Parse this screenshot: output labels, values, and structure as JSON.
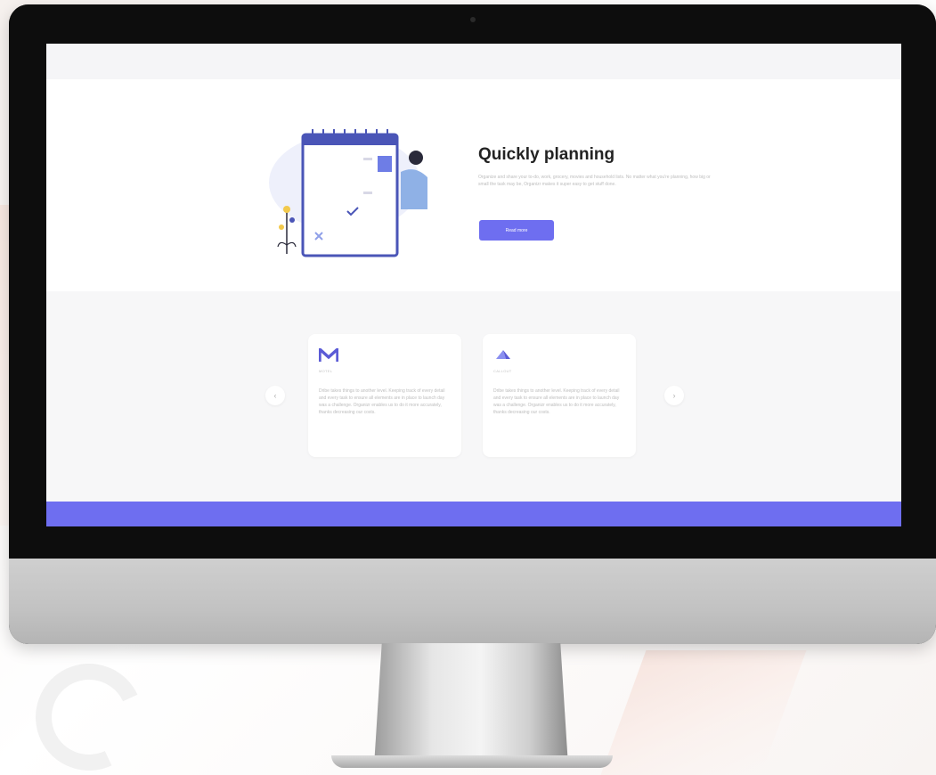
{
  "hero": {
    "title": "Quickly planning",
    "description": "Organize and share your to-do, work, grocery, movies and household lists. No matter what you're planning, how big or small the task may be, Organizr makes it super easy to get stuff done.",
    "button_label": "Read more"
  },
  "features": {
    "cards": [
      {
        "logo_icon": "m-logo-icon",
        "logo_text": "MOTEL",
        "text": "Dribe takes things to another level. Keeping track of every detail and every task to ensure all elements are in place to launch day was a challenge. Organizr enables us to do it more accurately, thanks decreasing our costs."
      },
      {
        "logo_icon": "megaphone-logo-icon",
        "logo_text": "CALLOUT",
        "text": "Dribe takes things to another level. Keeping track of every detail and every task to ensure all elements are in place to launch day was a challenge. Organizr enables us to do it more accurately, thanks decreasing our costs."
      }
    ],
    "prev_icon": "chevron-left-icon",
    "next_icon": "chevron-right-icon"
  },
  "colors": {
    "accent": "#6e6ef0",
    "title": "#232323",
    "muted_text": "#bdbdbd",
    "section_bg": "#f7f7f8"
  }
}
